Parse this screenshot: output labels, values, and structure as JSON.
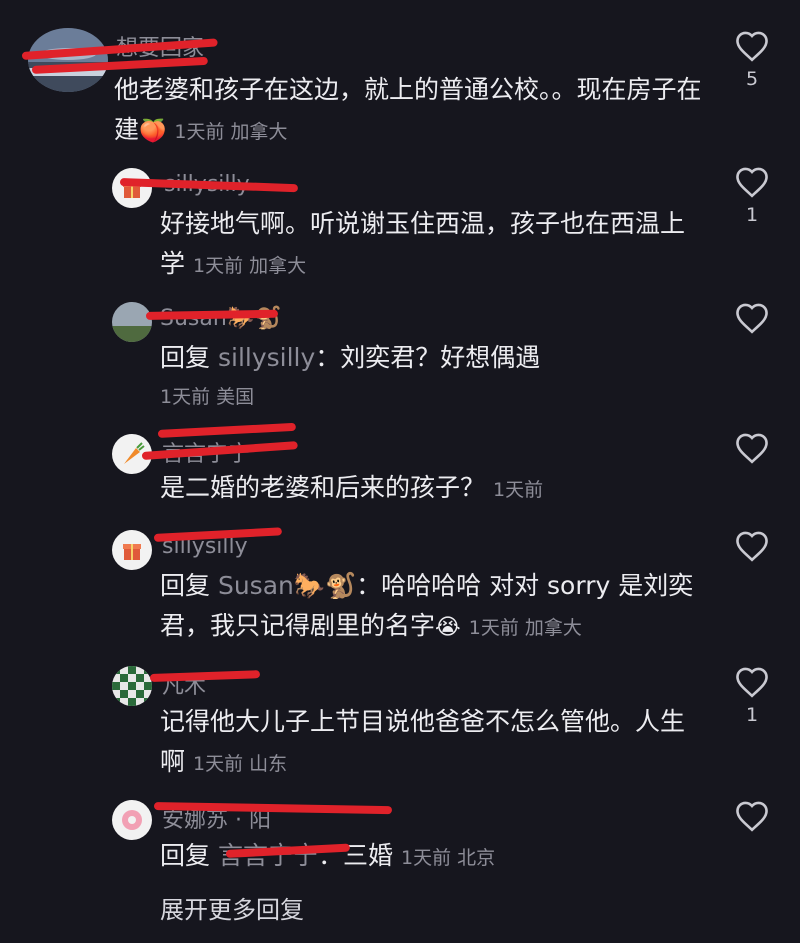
{
  "comments": [
    {
      "username": "想要回家",
      "text": "他老婆和孩子在这边，就上的普通公校。。现在房子在建",
      "emoji": "🍑",
      "meta": "1天前  加拿大",
      "likes": "5"
    },
    {
      "username": "sillysilly",
      "text": "好接地气啊。听说谢玉住西温，孩子也在西温上学",
      "meta": "1天前  加拿大",
      "likes": "1"
    },
    {
      "username": "Susan🐎🐒",
      "reply_prefix": "回复",
      "mention": "sillysilly",
      "text": "：刘奕君？好想偶遇",
      "meta": "1天前  美国",
      "likes": ""
    },
    {
      "username": "言言宁宁",
      "text": "是二婚的老婆和后来的孩子？",
      "meta": "1天前",
      "likes": ""
    },
    {
      "username": "sillysilly",
      "reply_prefix": "回复",
      "mention": "Susan🐎🐒",
      "text": "：哈哈哈哈 对对 sorry 是刘奕君，我只记得剧里的名字",
      "emoji": "😭",
      "meta": "1天前  加拿大",
      "likes": ""
    },
    {
      "username": "凡木",
      "text": "记得他大儿子上节目说他爸爸不怎么管他。人生啊",
      "meta": "1天前  山东",
      "likes": "1"
    },
    {
      "username": "安娜苏 · 阳",
      "reply_prefix": "回复",
      "mention": "言言宁宁",
      "text": "：三婚",
      "meta": "1天前  北京",
      "likes": ""
    }
  ],
  "expand_label": "展开更多回复",
  "colors": {
    "redaction": "#e0222a",
    "background": "#16161e",
    "muted": "#8d8d98"
  }
}
